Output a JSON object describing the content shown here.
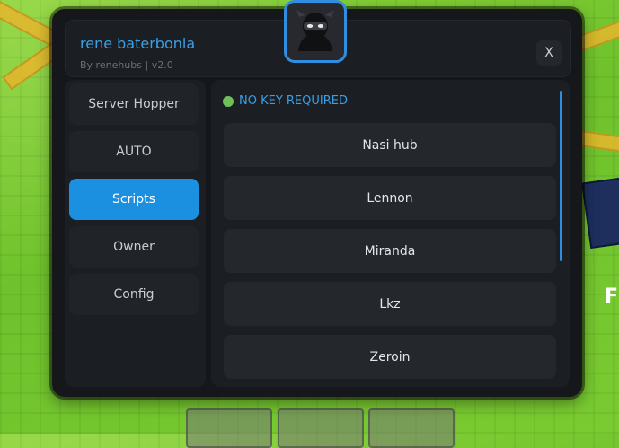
{
  "window": {
    "title": "rene baterbonia",
    "subtitle": "By renehubs | v2.0",
    "close_label": "X",
    "avatar_icon": "ninja-avatar-icon"
  },
  "sidebar": {
    "items": [
      {
        "label": "Server Hopper",
        "active": false
      },
      {
        "label": "AUTO",
        "active": false
      },
      {
        "label": "Scripts",
        "active": true
      },
      {
        "label": "Owner",
        "active": false
      },
      {
        "label": "Config",
        "active": false
      }
    ]
  },
  "content": {
    "status_label": "NO KEY REQUIRED",
    "scripts": [
      "Nasi hub",
      "Lennon",
      "Miranda",
      "Lkz",
      "Zeroin"
    ]
  },
  "colors": {
    "accent": "#1b8fe0",
    "title": "#3aa0e6",
    "status_dot": "#6fbf5b",
    "panel": "#1b1e22",
    "window": "#15171b"
  }
}
